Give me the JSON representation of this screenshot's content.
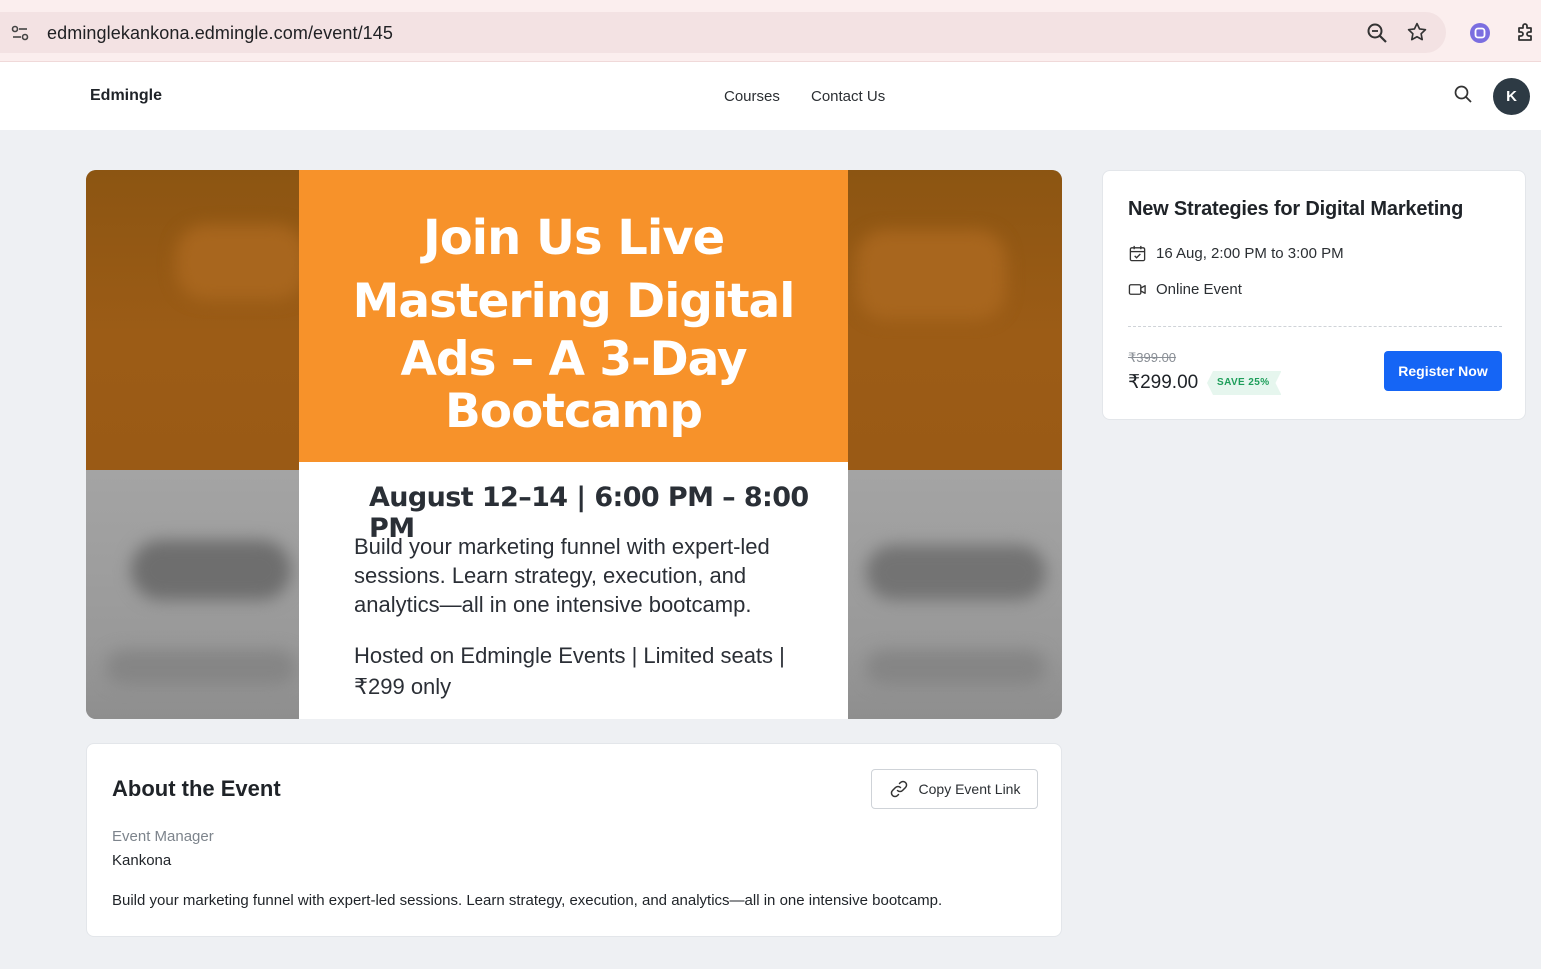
{
  "browser": {
    "url": "edminglekankona.edmingle.com/event/145",
    "icons": [
      "site-settings-icon",
      "zoom-icon",
      "bookmark-star-icon",
      "extension-icon",
      "puzzle-icon"
    ]
  },
  "header": {
    "brand": "Edmingle",
    "nav": [
      "Courses",
      "Contact Us"
    ],
    "avatar_initial": "K"
  },
  "banner": {
    "line1": "Join Us Live",
    "line2": "Mastering Digital",
    "line3": "Ads – A 3-Day",
    "line4": "Bootcamp",
    "date_time": "August 12–14 | 6:00 PM – 8:00 PM",
    "description": "Build your marketing funnel with expert-led sessions. Learn strategy, execution, and analytics—all in one intensive bootcamp.",
    "hosting": "Hosted on Edmingle Events | Limited seats | ₹299 only",
    "colors": {
      "orange": "#f7922a",
      "text_dark": "#2a2f36"
    }
  },
  "event_card": {
    "title": "New Strategies for Digital Marketing",
    "schedule": "16 Aug, 2:00 PM to 3:00 PM",
    "mode": "Online Event",
    "original_price": "₹399.00",
    "price": "₹299.00",
    "save_badge": "SAVE 25%",
    "register_label": "Register Now",
    "accent_color": "#1565f5"
  },
  "about": {
    "title": "About the Event",
    "copy_link_label": "Copy Event Link",
    "manager_label": "Event Manager",
    "manager_name": "Kankona",
    "description": "Build your marketing funnel with expert-led sessions. Learn strategy, execution, and analytics—all in one intensive bootcamp."
  }
}
